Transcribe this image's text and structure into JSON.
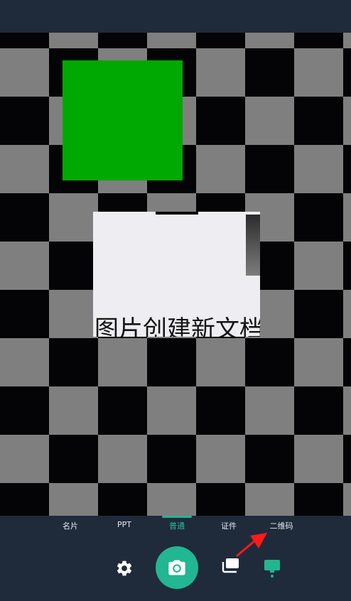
{
  "viewfinder": {
    "document_text": "图片创建新文档"
  },
  "modes": {
    "items": [
      {
        "label": "名片"
      },
      {
        "label": "PPT"
      },
      {
        "label": "普通"
      },
      {
        "label": "证件"
      },
      {
        "label": "二维码"
      }
    ],
    "active": "普通"
  },
  "controls": {
    "settings_icon": "gear-icon",
    "shutter_icon": "camera-icon",
    "gallery_icon": "gallery-icon",
    "doc_mode_icon": "monitor-icon"
  },
  "colors": {
    "accent": "#22b692",
    "green_block": "#00a802",
    "annotation_arrow": "#ff1a1a"
  }
}
